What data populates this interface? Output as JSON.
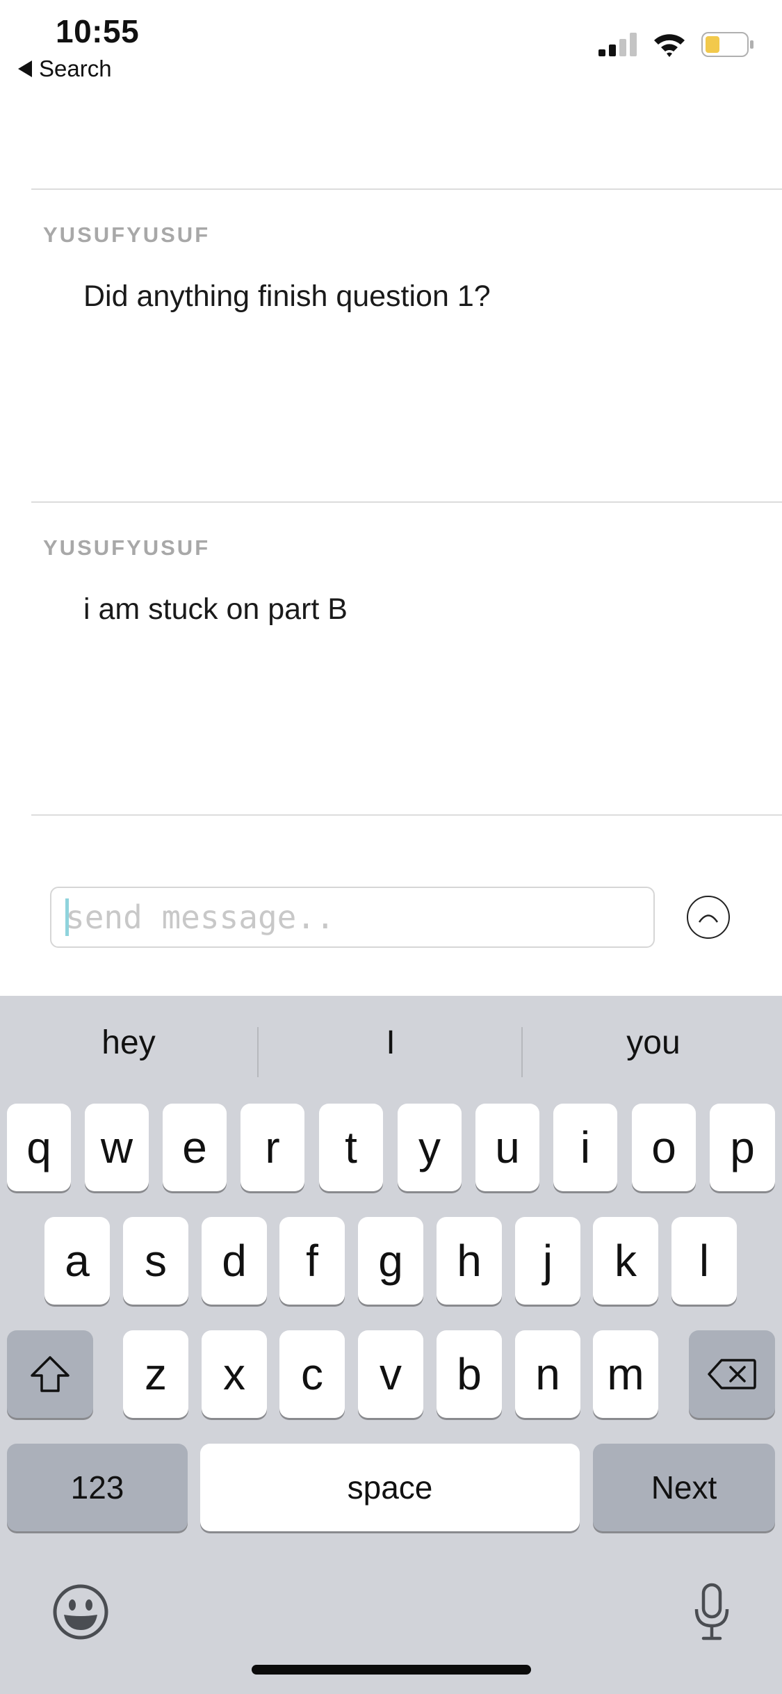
{
  "status_bar": {
    "time": "10:55",
    "back_label": "Search",
    "back_icon": "back-arrow-icon",
    "signal_icon": "cellular-signal-icon",
    "wifi_icon": "wifi-icon",
    "battery_icon": "battery-icon",
    "battery_color": "#f2c94c"
  },
  "feed": {
    "posts": [
      {
        "author": "YUSUFYUSUF",
        "message": "Did anything finish question 1?"
      },
      {
        "author": "YUSUFYUSUF",
        "message": "i am stuck on part B"
      }
    ]
  },
  "composer": {
    "placeholder": "send message..",
    "value": "",
    "send_icon": "chevron-up-icon",
    "caret_color": "#8fd3dc"
  },
  "keyboard": {
    "suggestions": [
      "hey",
      "I",
      "you"
    ],
    "row1": [
      "q",
      "w",
      "e",
      "r",
      "t",
      "y",
      "u",
      "i",
      "o",
      "p"
    ],
    "row2": [
      "a",
      "s",
      "d",
      "f",
      "g",
      "h",
      "j",
      "k",
      "l"
    ],
    "row3": [
      "z",
      "x",
      "c",
      "v",
      "b",
      "n",
      "m"
    ],
    "numbers_label": "123",
    "space_label": "space",
    "next_label": "Next",
    "shift_icon": "shift-icon",
    "delete_icon": "backspace-icon",
    "emoji_icon": "emoji-icon",
    "mic_icon": "microphone-icon",
    "background_color": "#d1d3d9"
  }
}
